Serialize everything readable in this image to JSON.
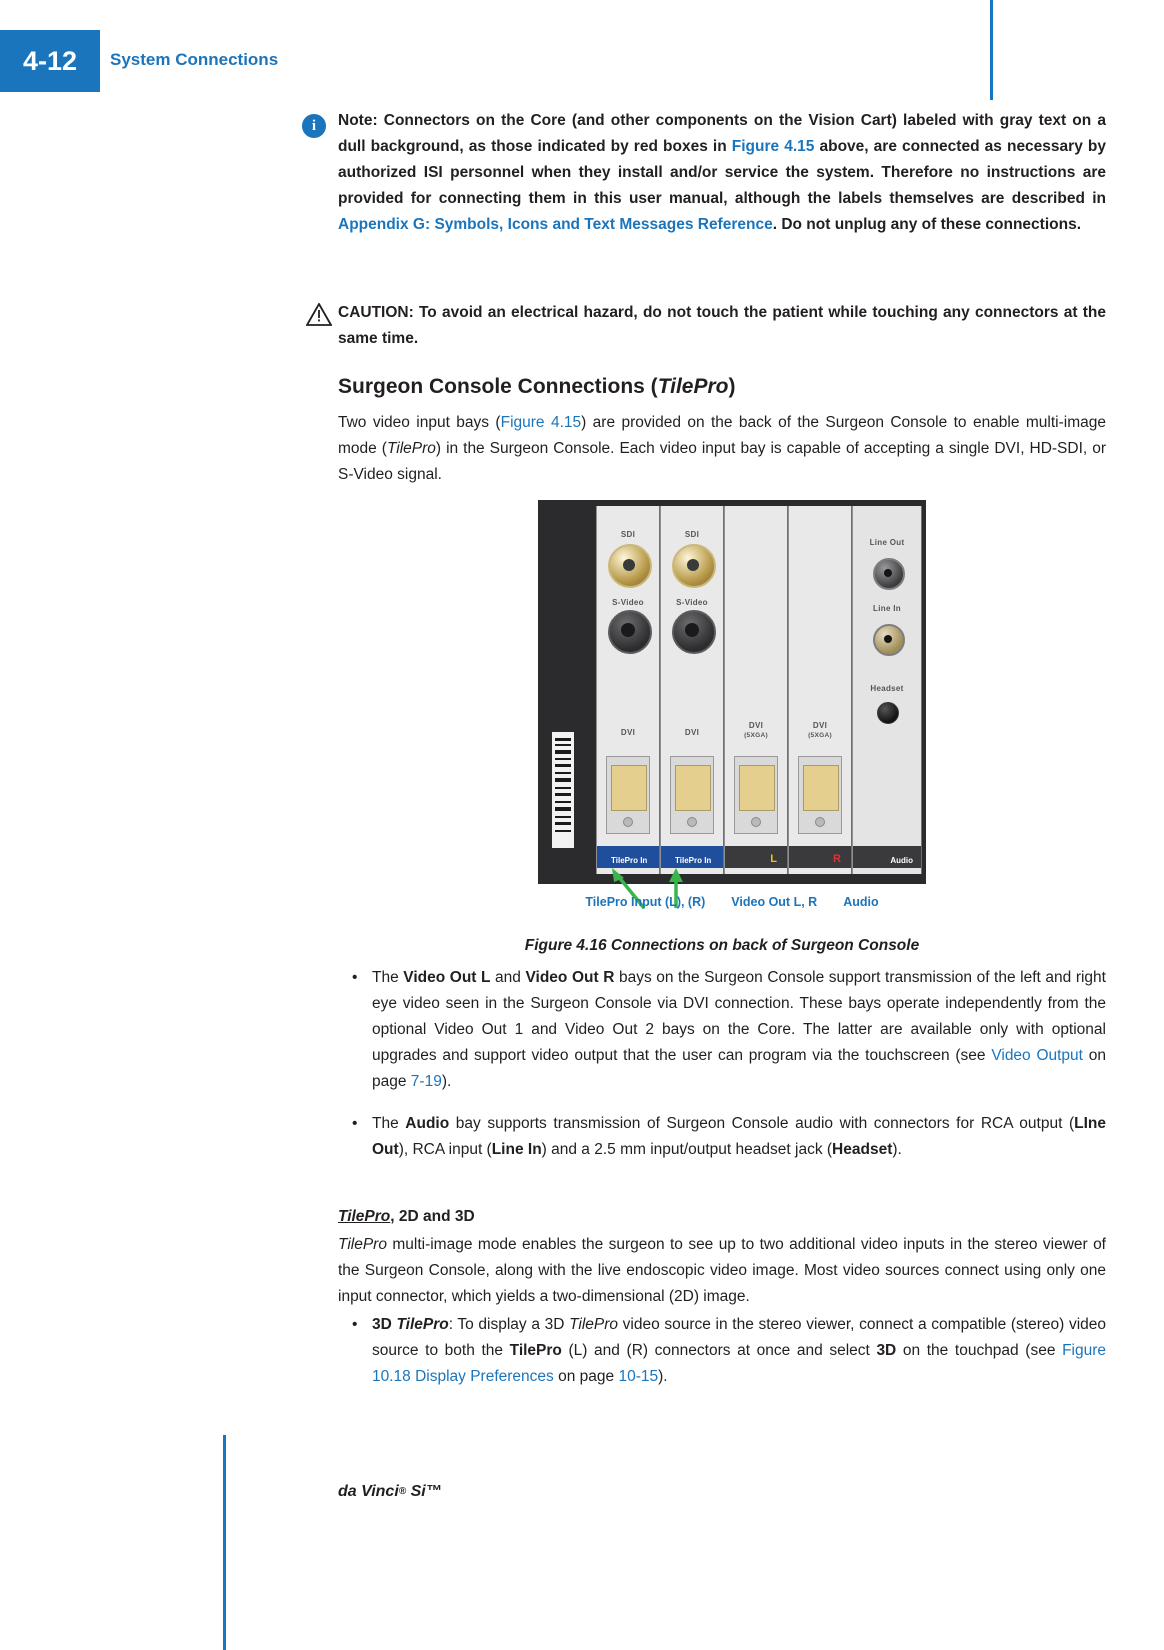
{
  "header": {
    "page_number": "4-12",
    "chapter_title": "System Connections"
  },
  "footer": {
    "text": "da Vinci",
    "reg": "®",
    "model": " Si™"
  },
  "note": {
    "icon": "info-icon",
    "label": "Note:",
    "line1": " Connectors on the Core (and other components on the Vision Cart) labeled with gray text on a dull background, as those indicated by red boxes in ",
    "link1": "Figure 4.15",
    "line2": " above, are connected as necessary by authorized ISI personnel when they install and/or service the system. Therefore no instructions are provided for connecting them in this user manual, although the labels themselves are described in ",
    "link2": "Appendix G: Symbols, Icons and Text Messages Reference",
    "line3": ". Do not unplug any of these connections."
  },
  "caution": {
    "icon": "warning-triangle-icon",
    "text": "CAUTION: To avoid an electrical hazard, do not touch the patient while touching any connectors at the same time."
  },
  "section": {
    "heading_plain": "Surgeon Console Connections (",
    "heading_italic": "TilePro",
    "heading_close": ")",
    "intro_a": "Two video input bays (",
    "intro_link": "Figure 4.15",
    "intro_b": ") are provided on the back of the Surgeon Console to enable multi-image mode (",
    "intro_italic": "TilePro",
    "intro_c": ") in the Surgeon Console. Each video input bay is capable of accepting a single DVI, HD-SDI, or S-Video signal."
  },
  "figure": {
    "panel_labels": {
      "sdi_left": "SDI",
      "sdi_right": "SDI",
      "svideo_left": "S-Video",
      "svideo_right": "S-Video",
      "dvi_1": "DVI",
      "dvi_2": "DVI",
      "dvi_3": "DVI",
      "dvi_3_sub": "(5XGA)",
      "dvi_4": "DVI",
      "dvi_4_sub": "(5XGA)",
      "line_out": "Line Out",
      "line_in": "Line In",
      "headset": "Headset",
      "tilepro_in_l": "TilePro In",
      "tilepro_in_r": "TilePro In",
      "video_out_l": "L",
      "video_out_r": "R",
      "audio": "Audio"
    },
    "callouts": [
      "TilePro Input (L), (R)",
      "Video Out L, R",
      "Audio"
    ],
    "caption": "Figure 4.16 Connections on back of Surgeon Console"
  },
  "bullets": [
    {
      "segments": [
        {
          "t": "The ",
          "s": "n"
        },
        {
          "t": "Video Out L",
          "s": "b"
        },
        {
          "t": " and ",
          "s": "n"
        },
        {
          "t": "Video Out R",
          "s": "b"
        },
        {
          "t": " bays on the Surgeon Console support transmission of the left and right eye video seen in the Surgeon Console via DVI connection. These bays operate independently from the optional Video Out 1 and Video Out 2 bays on the Core. The latter are available only with optional upgrades and support video output that the user can program via the touchscreen (see ",
          "s": "n"
        },
        {
          "t": "Video Output",
          "s": "l"
        },
        {
          "t": " on page ",
          "s": "n"
        },
        {
          "t": "7-19",
          "s": "l"
        },
        {
          "t": ").",
          "s": "n"
        }
      ]
    },
    {
      "segments": [
        {
          "t": "The ",
          "s": "n"
        },
        {
          "t": "Audio",
          "s": "b"
        },
        {
          "t": " bay supports transmission of Surgeon Console audio with connectors for RCA output (",
          "s": "n"
        },
        {
          "t": "LIne Out",
          "s": "b"
        },
        {
          "t": "), RCA input (",
          "s": "n"
        },
        {
          "t": "Line In",
          "s": "b"
        },
        {
          "t": ") and a 2.5 mm input/output headset jack (",
          "s": "n"
        },
        {
          "t": "Headset",
          "s": "b"
        },
        {
          "t": ").",
          "s": "n"
        }
      ]
    }
  ],
  "subsection": {
    "title_italic": "TilePro",
    "title_rest": ", 2D and 3D",
    "paragraph": "TilePro multi-image mode enables the surgeon to see up to two additional video inputs in the stereo viewer of the Surgeon Console, along with the live endoscopic video image. Most video sources connect using only one input connector, which yields a two-dimensional (2D) image.",
    "paragraph_lead_italic": "TilePro"
  },
  "bullets2": [
    {
      "segments": [
        {
          "t": "3D ",
          "s": "b"
        },
        {
          "t": "TilePro",
          "s": "bi"
        },
        {
          "t": ": To display a 3D ",
          "s": "n"
        },
        {
          "t": "TilePro",
          "s": "i"
        },
        {
          "t": " video source in the stereo viewer, connect a compatible (stereo) video source to both the ",
          "s": "n"
        },
        {
          "t": "TilePro",
          "s": "b"
        },
        {
          "t": " (L) and (R) connectors at once and select ",
          "s": "n"
        },
        {
          "t": "3D",
          "s": "b"
        },
        {
          "t": " on the touchpad (see ",
          "s": "n"
        },
        {
          "t": "Figure 10.18 Display Preferences",
          "s": "l"
        },
        {
          "t": " on page ",
          "s": "n"
        },
        {
          "t": "10-15",
          "s": "l"
        },
        {
          "t": ").",
          "s": "n"
        }
      ]
    }
  ],
  "colors": {
    "accent_blue": "#1b75bc",
    "text": "#231f20",
    "callout_green": "#39b54a"
  }
}
